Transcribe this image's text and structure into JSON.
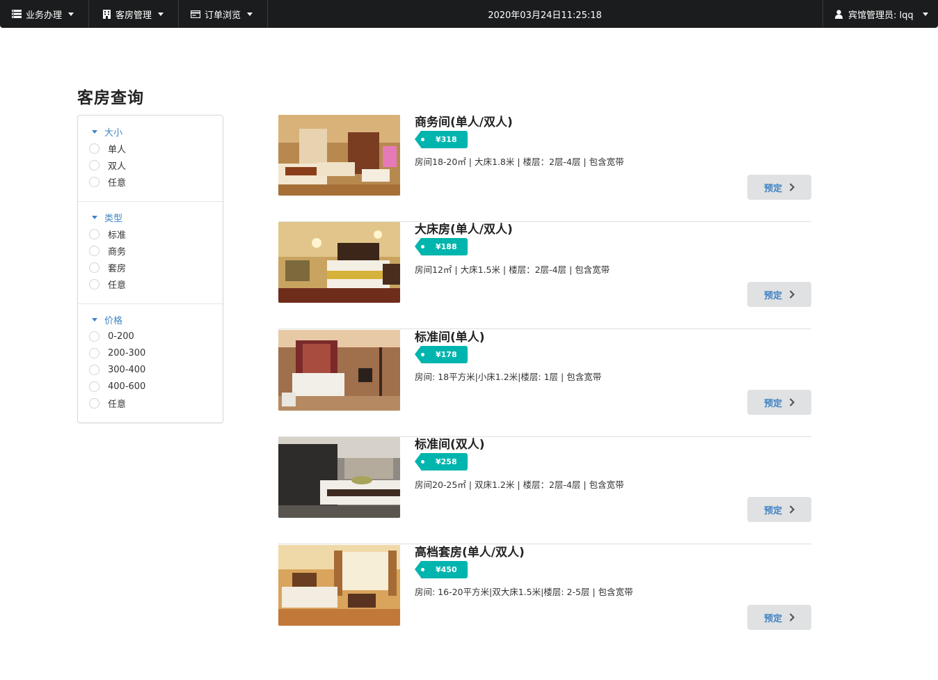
{
  "nav": {
    "menus": [
      {
        "label": "业务办理",
        "icon": "list-icon"
      },
      {
        "label": "客房管理",
        "icon": "building-icon"
      },
      {
        "label": "订单浏览",
        "icon": "card-icon"
      }
    ],
    "datetime": "2020年03月24日11:25:18",
    "user_label": "宾馆管理员: lqq"
  },
  "page": {
    "title": "客房查询"
  },
  "filters": [
    {
      "title": "大小",
      "options": [
        "单人",
        "双人",
        "任意"
      ]
    },
    {
      "title": "类型",
      "options": [
        "标准",
        "商务",
        "套房",
        "任意"
      ]
    },
    {
      "title": "价格",
      "options": [
        "0-200",
        "200-300",
        "300-400",
        "400-600",
        "任意"
      ]
    }
  ],
  "rooms": [
    {
      "name": "商务间(单人/双人)",
      "price": "¥318",
      "desc": "房间18-20㎡ | 大床1.8米 | 楼层：2层-4层 | 包含宽带",
      "button": "预定"
    },
    {
      "name": "大床房(单人/双人)",
      "price": "¥188",
      "desc": "房间12㎡ | 大床1.5米 | 楼层：2层-4层 | 包含宽带",
      "button": "预定"
    },
    {
      "name": "标准间(单人)",
      "price": "¥178",
      "desc": "房间: 18平方米|小床1.2米|楼层: 1层 | 包含宽带",
      "button": "预定"
    },
    {
      "name": "标准间(双人)",
      "price": "¥258",
      "desc": "房间20-25㎡ | 双床1.2米 | 楼层：2层-4层 | 包含宽带",
      "button": "预定"
    },
    {
      "name": "高档套房(单人/双人)",
      "price": "¥450",
      "desc": "房间: 16-20平方米|双大床1.5米|楼层: 2-5层 | 包含宽带",
      "button": "预定"
    }
  ],
  "colors": {
    "topbar": "#1b1c1d",
    "accent": "#4183c4",
    "tag": "#00b5ad",
    "button_bg": "#e0e1e2"
  }
}
